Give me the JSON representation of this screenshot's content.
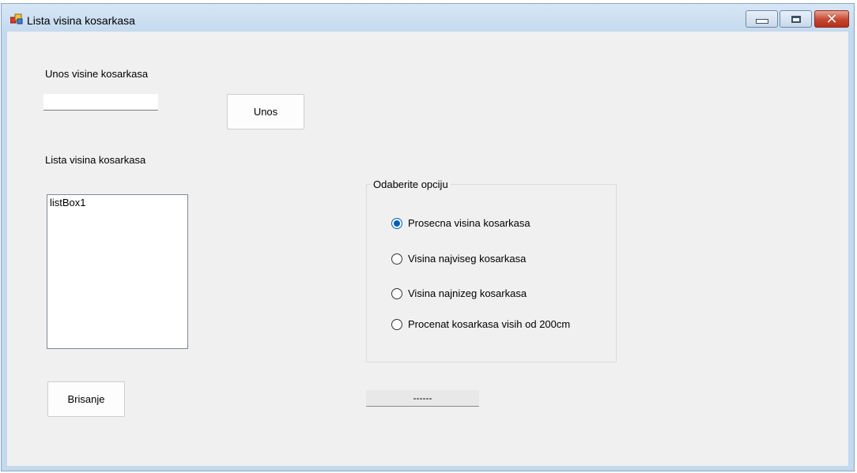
{
  "window": {
    "title": "Lista visina kosarkasa",
    "icon": "app-icon",
    "caption_buttons": [
      "minimize-icon",
      "maximize-icon",
      "close-icon"
    ]
  },
  "form": {
    "input_label": "Unos visine kosarkasa",
    "input_value": "",
    "unos_button": "Unos",
    "list_label": "Lista visina kosarkasa",
    "list_items": [
      "listBox1"
    ],
    "brisanje_button": "Brisanje",
    "group_title": "Odaberite opciju",
    "options": [
      {
        "label": "Prosecna visina kosarkasa",
        "checked": true
      },
      {
        "label": "Visina najviseg kosarkasa",
        "checked": false
      },
      {
        "label": "Visina najnizeg kosarkasa",
        "checked": false
      },
      {
        "label": "Procenat kosarkasa visih od 200cm",
        "checked": false
      }
    ],
    "result_text": "------"
  },
  "colors": {
    "accent": "#005fb8",
    "client_bg": "#f0f0f0",
    "frame": "#c3d9ef"
  }
}
